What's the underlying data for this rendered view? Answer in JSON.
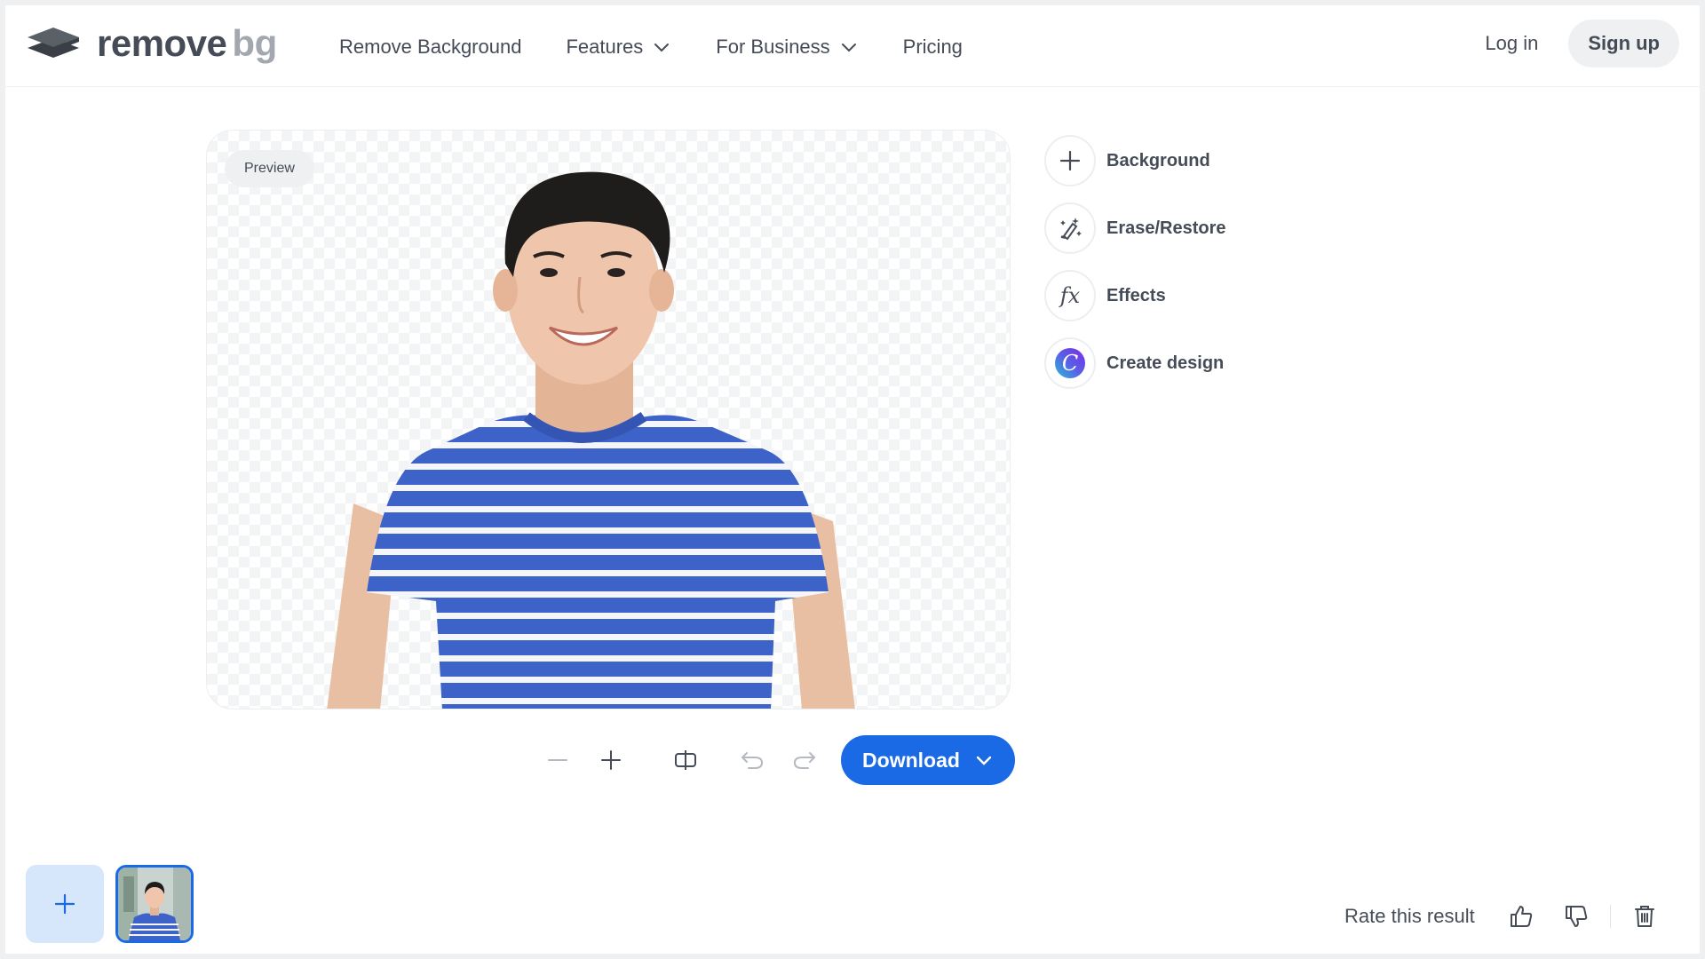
{
  "brand": {
    "word1": "remove",
    "word2": "bg"
  },
  "nav": {
    "items": [
      {
        "label": "Remove Background",
        "has_dropdown": false
      },
      {
        "label": "Features",
        "has_dropdown": true
      },
      {
        "label": "For Business",
        "has_dropdown": true
      },
      {
        "label": "Pricing",
        "has_dropdown": false
      }
    ]
  },
  "auth": {
    "login": "Log in",
    "signup": "Sign up"
  },
  "editor": {
    "preview_label": "Preview",
    "tools": [
      {
        "label": "Background",
        "icon": "plus-icon"
      },
      {
        "label": "Erase/Restore",
        "icon": "magic-brush-icon"
      },
      {
        "label": "Effects",
        "icon": "fx-icon",
        "glyph": "fx"
      },
      {
        "label": "Create design",
        "icon": "canva-logo-icon",
        "glyph": "C"
      }
    ],
    "toolbar": {
      "zoom_out": "minus-icon",
      "zoom_in": "plus-icon",
      "compare": "compare-icon",
      "undo": "undo-icon",
      "redo": "redo-icon",
      "download_label": "Download"
    }
  },
  "footer": {
    "rate_label": "Rate this result"
  },
  "colors": {
    "accent": "#1a6ae6",
    "text": "#454c57",
    "muted": "#a3a8b0",
    "shirt_blue": "#3d63c9"
  }
}
